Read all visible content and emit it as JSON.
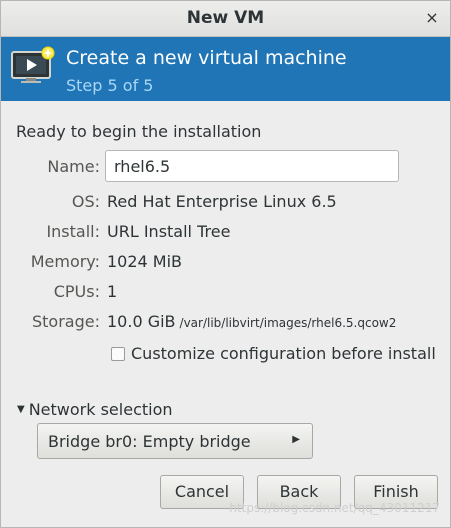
{
  "window": {
    "title": "New VM",
    "close_glyph": "×"
  },
  "banner": {
    "heading": "Create a new virtual machine",
    "step": "Step 5 of 5",
    "icon": "vm-new-icon",
    "background_color": "#1f75b6"
  },
  "summary": {
    "section_title": "Ready to begin the installation",
    "name_label": "Name:",
    "name_value": "rhel6.5",
    "os_label": "OS:",
    "os_value": "Red Hat Enterprise Linux 6.5",
    "install_label": "Install:",
    "install_value": "URL Install Tree",
    "memory_label": "Memory:",
    "memory_value": "1024 MiB",
    "cpus_label": "CPUs:",
    "cpus_value": "1",
    "storage_label": "Storage:",
    "storage_value": "10.0 GiB",
    "storage_path": "/var/lib/libvirt/images/rhel6.5.qcow2"
  },
  "customize": {
    "label": "Customize configuration before install",
    "checked": false
  },
  "network": {
    "expander_label": "Network selection",
    "selected": "Bridge br0: Empty bridge"
  },
  "buttons": {
    "cancel": "Cancel",
    "back": "Back",
    "finish": "Finish"
  },
  "watermark": "https://blog.csdn.net/qq_43011217"
}
